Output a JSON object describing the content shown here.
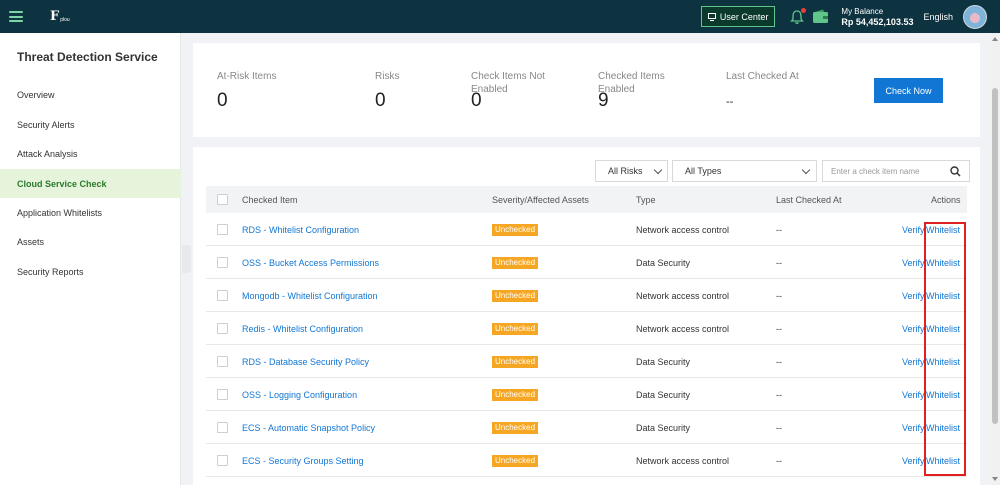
{
  "topbar": {
    "logo_mark": "F",
    "logo_text": "plou",
    "user_center": "User Center",
    "balance_label": "My Balance",
    "balance_amount": "Rp 54,452,103.53",
    "language": "English"
  },
  "sidebar": {
    "title": "Threat Detection Service",
    "items": [
      {
        "label": "Overview",
        "active": false
      },
      {
        "label": "Security Alerts",
        "active": false
      },
      {
        "label": "Attack Analysis",
        "active": false
      },
      {
        "label": "Cloud Service Check",
        "active": true
      },
      {
        "label": "Application Whitelists",
        "active": false
      },
      {
        "label": "Assets",
        "active": false
      },
      {
        "label": "Security Reports",
        "active": false
      }
    ]
  },
  "summary": {
    "at_risk": {
      "label": "At-Risk Items",
      "value": "0"
    },
    "risks": {
      "label": "Risks",
      "value": "0"
    },
    "not_enabled": {
      "label": "Check Items Not Enabled",
      "value": "0"
    },
    "checked": {
      "label": "Checked Items Enabled",
      "value": "9"
    },
    "last_checked": {
      "label": "Last Checked At",
      "value": "--"
    },
    "check_now": "Check Now"
  },
  "filters": {
    "risk": "All Risks",
    "type": "All Types",
    "search_placeholder": "Enter a check item name"
  },
  "table": {
    "headers": {
      "item": "Checked Item",
      "severity": "Severity/Affected Assets",
      "type": "Type",
      "last_checked": "Last Checked At",
      "actions": "Actions"
    },
    "rows": [
      {
        "item": "RDS - Whitelist Configuration",
        "severity": "Unchecked",
        "type": "Network access control",
        "last": "--"
      },
      {
        "item": "OSS - Bucket Access Permissions",
        "severity": "Unchecked",
        "type": "Data Security",
        "last": "--"
      },
      {
        "item": "Mongodb - Whitelist Configuration",
        "severity": "Unchecked",
        "type": "Network access control",
        "last": "--"
      },
      {
        "item": "Redis - Whitelist Configuration",
        "severity": "Unchecked",
        "type": "Network access control",
        "last": "--"
      },
      {
        "item": "RDS - Database Security Policy",
        "severity": "Unchecked",
        "type": "Data Security",
        "last": "--"
      },
      {
        "item": "OSS - Logging Configuration",
        "severity": "Unchecked",
        "type": "Data Security",
        "last": "--"
      },
      {
        "item": "ECS - Automatic Snapshot Policy",
        "severity": "Unchecked",
        "type": "Data Security",
        "last": "--"
      },
      {
        "item": "ECS - Security Groups Setting",
        "severity": "Unchecked",
        "type": "Network access control",
        "last": "--"
      }
    ],
    "action_verify": "Verify",
    "action_whitelist": "Whitelist"
  },
  "colors": {
    "topbar": "#0d3240",
    "accent_green": "#5fc58b",
    "link_blue": "#1277d4",
    "badge_orange": "#f5a623",
    "highlight_red": "#e02020"
  }
}
